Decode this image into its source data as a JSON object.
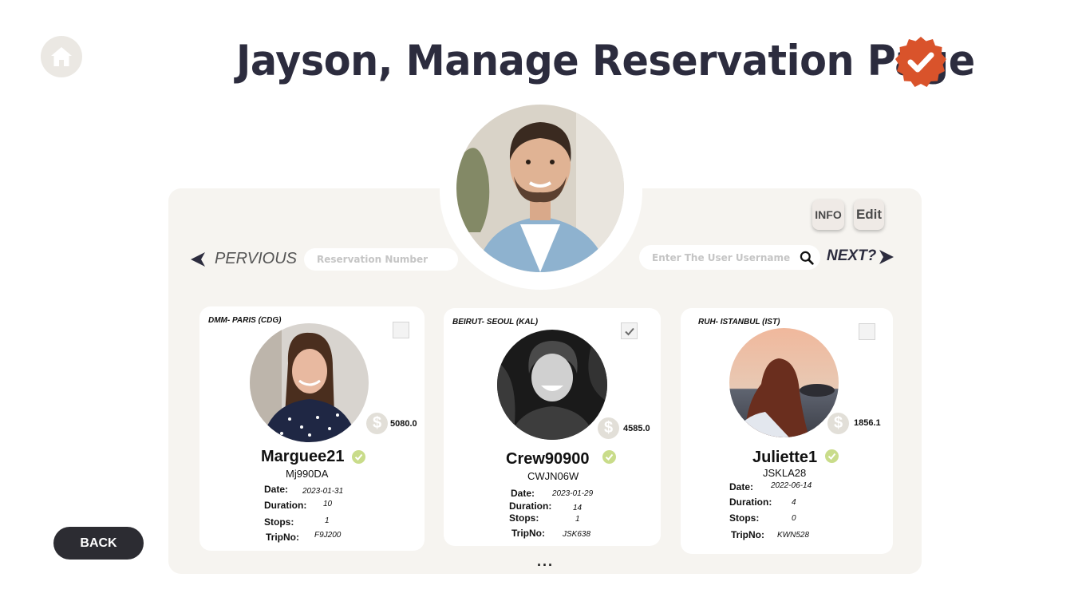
{
  "header": {
    "title": "Jayson, Manage Reservation Page",
    "home_icon": "home-icon",
    "verified_icon": "verified-badge-icon"
  },
  "actions": {
    "info_label": "INFO",
    "edit_label": "Edit"
  },
  "nav": {
    "prev_label": "PERVIOUS",
    "next_label": "NEXT?"
  },
  "search": {
    "reservation_placeholder": "Reservation Number",
    "username_placeholder": "Enter The User Username"
  },
  "cards": [
    {
      "route": "DMM- PARIS (CDG)",
      "username": "Marguee21",
      "code": "Mj990DA",
      "price": "5080.0",
      "checked": false,
      "date_label": "Date:",
      "date": "2023-01-31",
      "duration_label": "Duration:",
      "duration": "10",
      "stops_label": "Stops:",
      "stops": "1",
      "trip_label": "TripNo:",
      "trip": "F9J200"
    },
    {
      "route": "BEIRUT- SEOUL (KAL)",
      "username": "Crew90900",
      "code": "CWJN06W",
      "price": "4585.0",
      "checked": true,
      "date_label": "Date:",
      "date": "2023-01-29",
      "duration_label": "Duration:",
      "duration": "14",
      "stops_label": "Stops:",
      "stops": "1",
      "trip_label": "TripNo:",
      "trip": "JSK638"
    },
    {
      "route": "RUH- ISTANBUL (IST)",
      "username": "Juliette1",
      "code": "JSKLA28",
      "price": "1856.1",
      "checked": false,
      "date_label": "Date:",
      "date": "2022-06-14",
      "duration_label": "Duration:",
      "duration": "4",
      "stops_label": "Stops:",
      "stops": "0",
      "trip_label": "TripNo:",
      "trip": "KWN528"
    }
  ],
  "pagination": {
    "more": "..."
  },
  "footer": {
    "back_label": "BACK"
  },
  "colors": {
    "accent": "#d9532b",
    "verified_green": "#c9dc8a",
    "dark": "#2c2c3e"
  }
}
